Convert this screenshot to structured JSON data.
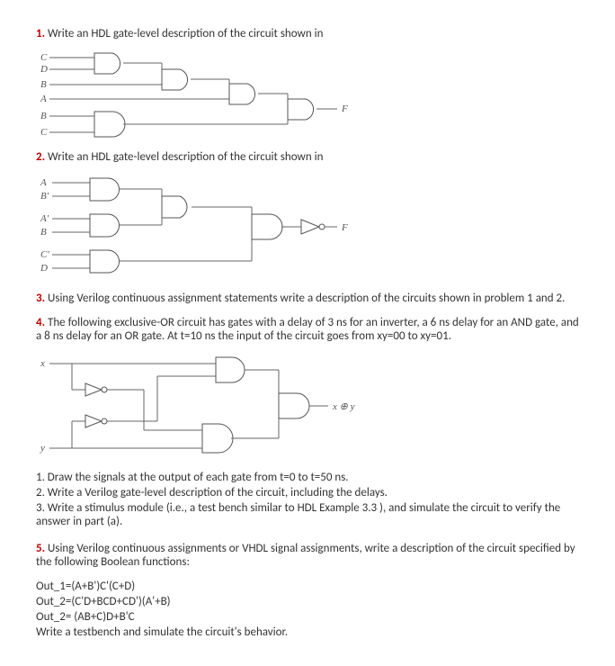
{
  "q1": {
    "num": "1.",
    "text": "Write an HDL gate-level description of the circuit shown in",
    "labels": {
      "C1": "C",
      "D": "D",
      "B1": "B",
      "A": "A",
      "B2": "B",
      "C2": "C",
      "F": "F"
    }
  },
  "q2": {
    "num": "2.",
    "text": "Write an HDL gate-level description of the circuit shown in",
    "labels": {
      "A": "A",
      "Bp": "B'",
      "Ap": "A'",
      "B": "B",
      "Cp": "C'",
      "D": "D",
      "F": "F"
    }
  },
  "q3": {
    "num": "3.",
    "text": "Using Verilog continuous assignment statements write a description of the circuits shown in problem 1 and 2."
  },
  "q4": {
    "num": "4.",
    "text": "The following exclusive-OR circuit has gates with a delay of 3 ns for an inverter, a 6 ns delay for an AND gate, and a 8 ns delay for an OR gate. At t=10 ns the input of the circuit goes from xy=00 to xy=01.",
    "labels": {
      "x": "x",
      "y": "y",
      "out": "x ⊕ y"
    },
    "sub1": "1. Draw the signals at the output of each gate from t=0 to t=50 ns.",
    "sub2": "2. Write a Verilog gate-level description of the circuit, including the delays.",
    "sub3": "3. Write a stimulus module (i.e., a test bench similar to HDL Example 3.3 ), and simulate the circuit to verify the answer in part (a)."
  },
  "q5": {
    "num": "5.",
    "text": "Using Verilog continuous assignments or VHDL signal assignments, write a description of the circuit specified by the following Boolean functions:",
    "eq1": "Out_1=(A+B')C'(C+D)",
    "eq2": "Out_2=(C'D+BCD+CD')(A'+B)",
    "eq3": "Out_2= (AB+C)D+B'C",
    "tail": "Write a testbench and simulate the circuit's behavior."
  }
}
